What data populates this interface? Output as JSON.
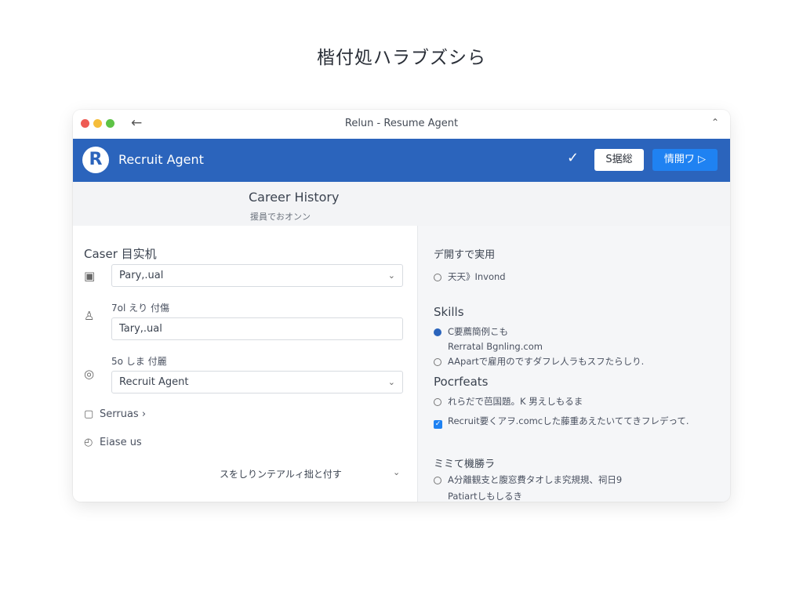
{
  "page_heading": "楷付処ハラブズシら",
  "window": {
    "title": "Relun - Resume Agent",
    "back_icon": "arrow-left-icon",
    "collapse_icon": "chevron-up-icon"
  },
  "appbar": {
    "logo_letter": "R",
    "app_name": "Recruit Agent",
    "secondary_button": "S据総",
    "primary_button": "情開ワ ▷",
    "accent_color": "#2b64bc",
    "primary_color": "#1f82f2"
  },
  "section": {
    "title": "Career History",
    "subtitle": "援員でおオンン"
  },
  "form": {
    "heading": "Caser 目实机",
    "field1_value": "Pary,.ual",
    "field2_label": "7ol えり 付傷",
    "field2_value": "Tary,.ual",
    "field3_label": "5o しま 付麗",
    "field3_value": "Recruit Agent",
    "link1": "Serruas ›",
    "link2": "Eiase us",
    "bottom_toggle": "スをしりンテアルィ拙と付す"
  },
  "right": {
    "group1_heading": "デ開すで実用",
    "group1_option": "天天》Invond",
    "skills_heading": "Skills",
    "skills_option1": "C要薦簡例こも",
    "skills_line": "Rerratal Bgnling.com",
    "skills_option2": "AApartで雇用のですダフレ人ラもスフたらしり.",
    "features_heading": "Pocrfeats",
    "features_option1": "れらだで芭国題。K 男えしもるま",
    "features_option2": "Recruit要くアヲ.comcした藤重あえたいててきフレデって.",
    "group4_heading": "ミミて機勝ラ",
    "group4_option": "A分離観支と腹窓費タオしま究規規、祠日9",
    "group4_line": "Patiartしもしるき"
  }
}
